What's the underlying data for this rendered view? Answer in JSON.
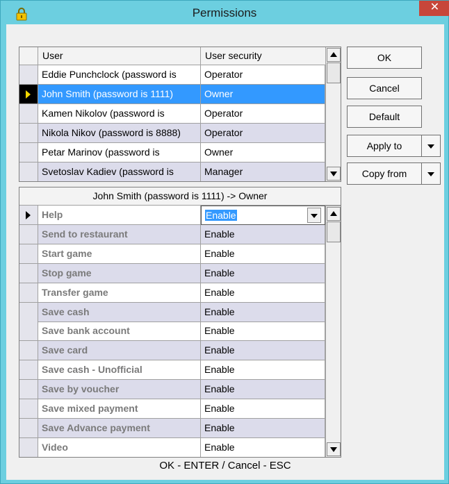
{
  "window": {
    "title": "Permissions",
    "close_glyph": "✕",
    "title_icon": "lock-icon",
    "accent_color": "#6ccfe0"
  },
  "users_grid": {
    "columns": [
      "User",
      "User security"
    ],
    "rows": [
      {
        "user": "Eddie Punchclock (password is",
        "security": "Operator"
      },
      {
        "user": "John Smith (password is 1111)",
        "security": "Owner"
      },
      {
        "user": "Kamen Nikolov (password is",
        "security": "Operator"
      },
      {
        "user": "Nikola Nikov (password is 8888)",
        "security": "Operator"
      },
      {
        "user": "Petar Marinov (password is",
        "security": "Owner"
      },
      {
        "user": "Svetoslav Kadiev (password is",
        "security": "Manager"
      }
    ],
    "selected_index": 1
  },
  "permissions_grid": {
    "caption": "John Smith (password is 1111) -> Owner",
    "rows": [
      {
        "label": "Help",
        "value": "Enable"
      },
      {
        "label": "Send to restaurant",
        "value": "Enable"
      },
      {
        "label": "Start game",
        "value": "Enable"
      },
      {
        "label": "Stop game",
        "value": "Enable"
      },
      {
        "label": "Transfer game",
        "value": "Enable"
      },
      {
        "label": "Save cash",
        "value": "Enable"
      },
      {
        "label": "Save bank account",
        "value": "Enable"
      },
      {
        "label": "Save card",
        "value": "Enable"
      },
      {
        "label": "Save cash - Unofficial",
        "value": "Enable"
      },
      {
        "label": "Save by voucher",
        "value": "Enable"
      },
      {
        "label": "Save mixed payment",
        "value": "Enable"
      },
      {
        "label": "Save Advance payment",
        "value": "Enable"
      },
      {
        "label": "Video",
        "value": "Enable"
      }
    ]
  },
  "buttons": {
    "ok": "OK",
    "cancel": "Cancel",
    "default": "Default",
    "apply_to": "Apply to",
    "copy_from": "Copy from"
  },
  "footer": "OK - ENTER / Cancel - ESC"
}
